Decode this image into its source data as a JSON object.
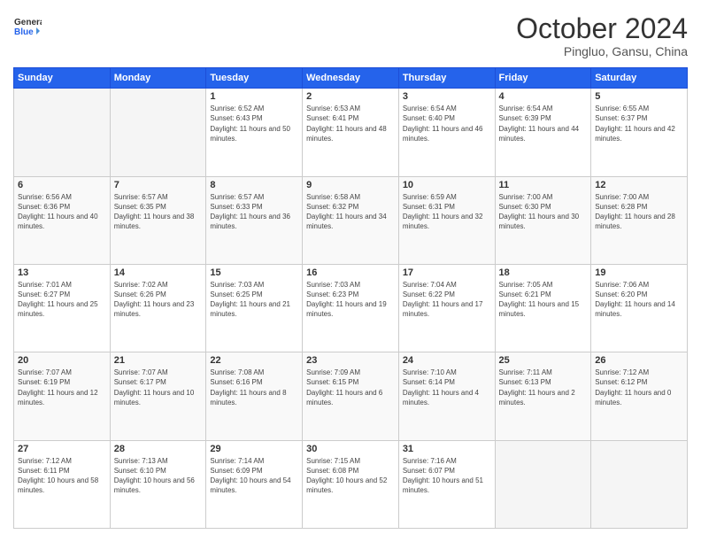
{
  "logo": {
    "line1": "General",
    "line2": "Blue"
  },
  "title": "October 2024",
  "location": "Pingluo, Gansu, China",
  "days_of_week": [
    "Sunday",
    "Monday",
    "Tuesday",
    "Wednesday",
    "Thursday",
    "Friday",
    "Saturday"
  ],
  "weeks": [
    [
      null,
      null,
      {
        "day": 1,
        "sunrise": "6:52 AM",
        "sunset": "6:43 PM",
        "daylight": "11 hours and 50 minutes."
      },
      {
        "day": 2,
        "sunrise": "6:53 AM",
        "sunset": "6:41 PM",
        "daylight": "11 hours and 48 minutes."
      },
      {
        "day": 3,
        "sunrise": "6:54 AM",
        "sunset": "6:40 PM",
        "daylight": "11 hours and 46 minutes."
      },
      {
        "day": 4,
        "sunrise": "6:54 AM",
        "sunset": "6:39 PM",
        "daylight": "11 hours and 44 minutes."
      },
      {
        "day": 5,
        "sunrise": "6:55 AM",
        "sunset": "6:37 PM",
        "daylight": "11 hours and 42 minutes."
      }
    ],
    [
      {
        "day": 6,
        "sunrise": "6:56 AM",
        "sunset": "6:36 PM",
        "daylight": "11 hours and 40 minutes."
      },
      {
        "day": 7,
        "sunrise": "6:57 AM",
        "sunset": "6:35 PM",
        "daylight": "11 hours and 38 minutes."
      },
      {
        "day": 8,
        "sunrise": "6:57 AM",
        "sunset": "6:33 PM",
        "daylight": "11 hours and 36 minutes."
      },
      {
        "day": 9,
        "sunrise": "6:58 AM",
        "sunset": "6:32 PM",
        "daylight": "11 hours and 34 minutes."
      },
      {
        "day": 10,
        "sunrise": "6:59 AM",
        "sunset": "6:31 PM",
        "daylight": "11 hours and 32 minutes."
      },
      {
        "day": 11,
        "sunrise": "7:00 AM",
        "sunset": "6:30 PM",
        "daylight": "11 hours and 30 minutes."
      },
      {
        "day": 12,
        "sunrise": "7:00 AM",
        "sunset": "6:28 PM",
        "daylight": "11 hours and 28 minutes."
      }
    ],
    [
      {
        "day": 13,
        "sunrise": "7:01 AM",
        "sunset": "6:27 PM",
        "daylight": "11 hours and 25 minutes."
      },
      {
        "day": 14,
        "sunrise": "7:02 AM",
        "sunset": "6:26 PM",
        "daylight": "11 hours and 23 minutes."
      },
      {
        "day": 15,
        "sunrise": "7:03 AM",
        "sunset": "6:25 PM",
        "daylight": "11 hours and 21 minutes."
      },
      {
        "day": 16,
        "sunrise": "7:03 AM",
        "sunset": "6:23 PM",
        "daylight": "11 hours and 19 minutes."
      },
      {
        "day": 17,
        "sunrise": "7:04 AM",
        "sunset": "6:22 PM",
        "daylight": "11 hours and 17 minutes."
      },
      {
        "day": 18,
        "sunrise": "7:05 AM",
        "sunset": "6:21 PM",
        "daylight": "11 hours and 15 minutes."
      },
      {
        "day": 19,
        "sunrise": "7:06 AM",
        "sunset": "6:20 PM",
        "daylight": "11 hours and 14 minutes."
      }
    ],
    [
      {
        "day": 20,
        "sunrise": "7:07 AM",
        "sunset": "6:19 PM",
        "daylight": "11 hours and 12 minutes."
      },
      {
        "day": 21,
        "sunrise": "7:07 AM",
        "sunset": "6:17 PM",
        "daylight": "11 hours and 10 minutes."
      },
      {
        "day": 22,
        "sunrise": "7:08 AM",
        "sunset": "6:16 PM",
        "daylight": "11 hours and 8 minutes."
      },
      {
        "day": 23,
        "sunrise": "7:09 AM",
        "sunset": "6:15 PM",
        "daylight": "11 hours and 6 minutes."
      },
      {
        "day": 24,
        "sunrise": "7:10 AM",
        "sunset": "6:14 PM",
        "daylight": "11 hours and 4 minutes."
      },
      {
        "day": 25,
        "sunrise": "7:11 AM",
        "sunset": "6:13 PM",
        "daylight": "11 hours and 2 minutes."
      },
      {
        "day": 26,
        "sunrise": "7:12 AM",
        "sunset": "6:12 PM",
        "daylight": "11 hours and 0 minutes."
      }
    ],
    [
      {
        "day": 27,
        "sunrise": "7:12 AM",
        "sunset": "6:11 PM",
        "daylight": "10 hours and 58 minutes."
      },
      {
        "day": 28,
        "sunrise": "7:13 AM",
        "sunset": "6:10 PM",
        "daylight": "10 hours and 56 minutes."
      },
      {
        "day": 29,
        "sunrise": "7:14 AM",
        "sunset": "6:09 PM",
        "daylight": "10 hours and 54 minutes."
      },
      {
        "day": 30,
        "sunrise": "7:15 AM",
        "sunset": "6:08 PM",
        "daylight": "10 hours and 52 minutes."
      },
      {
        "day": 31,
        "sunrise": "7:16 AM",
        "sunset": "6:07 PM",
        "daylight": "10 hours and 51 minutes."
      },
      null,
      null
    ]
  ]
}
